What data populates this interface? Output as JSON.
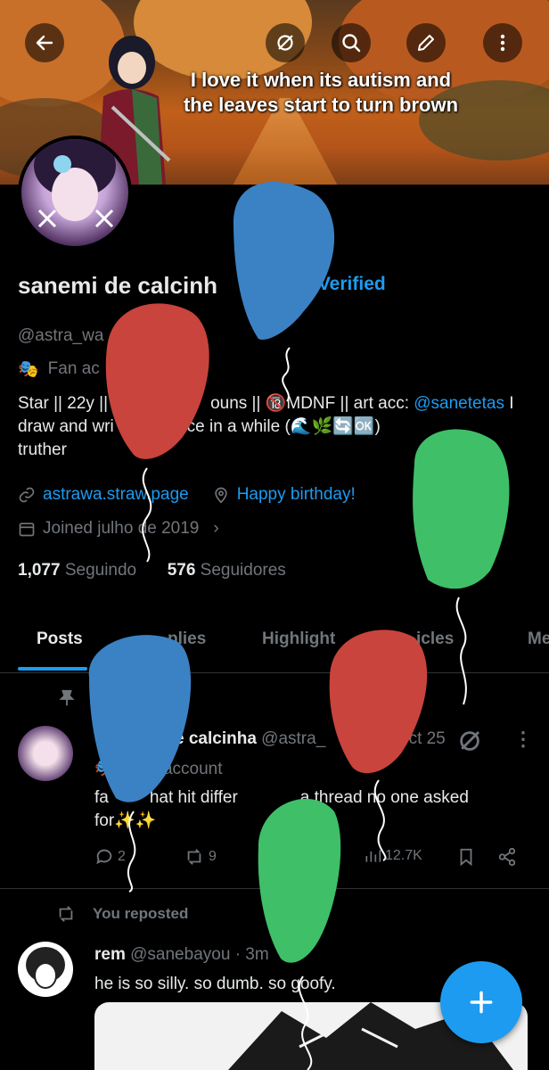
{
  "header": {
    "banner_text": "I love it when its autism and the leaves start to turn brown",
    "icons": [
      "back-arrow-icon",
      "grok-icon",
      "search-icon",
      "edit-icon",
      "more-vertical-icon"
    ]
  },
  "profile": {
    "name": "sanemi de calcinh",
    "verified_label": "t Verified",
    "handle": "@astra_wa",
    "category": "Fan ac",
    "bio_line1_a": "Star || 22y ||",
    "bio_line1_b": "ouns || ",
    "bio_line1_c": "MDNF || art acc:",
    "bio_art_link": "@sanetetas",
    "bio_line1_d": "I",
    "bio_line2_a": "draw and wri",
    "bio_line2_b": "y once in a while (",
    "bio_line2_c": ")",
    "bio_line3": "truther",
    "link": "astrawa.straw.page",
    "birthday": "Happy birthday!",
    "joined": "Joined julho de 2019",
    "following_count": "1,077",
    "following_label": "Seguindo",
    "followers_count": "576",
    "followers_label": "Seguidores"
  },
  "tabs": [
    "Posts",
    "plies",
    "Highlight",
    "icles",
    "Me"
  ],
  "posts": [
    {
      "name": "e calcinha",
      "handle": "@astra_",
      "date": "ct 25",
      "subtitle": "account",
      "text_line1_a": "fa",
      "text_line1_b": "hat hit differ",
      "text_line1_c": "a thread no one asked",
      "text_line2": "for",
      "replies": "2",
      "reposts": "9",
      "views": "12.7K"
    },
    {
      "repost_label": "You reposted",
      "name": "rem",
      "handle": "@sanebayou",
      "time": "· 3m",
      "text": "he is so silly. so dumb. so goofy."
    }
  ],
  "colors": {
    "accent": "#1d9bf0",
    "balloon_blue": "#3b82c4",
    "balloon_red": "#c8443c",
    "balloon_green": "#3fbf68"
  }
}
